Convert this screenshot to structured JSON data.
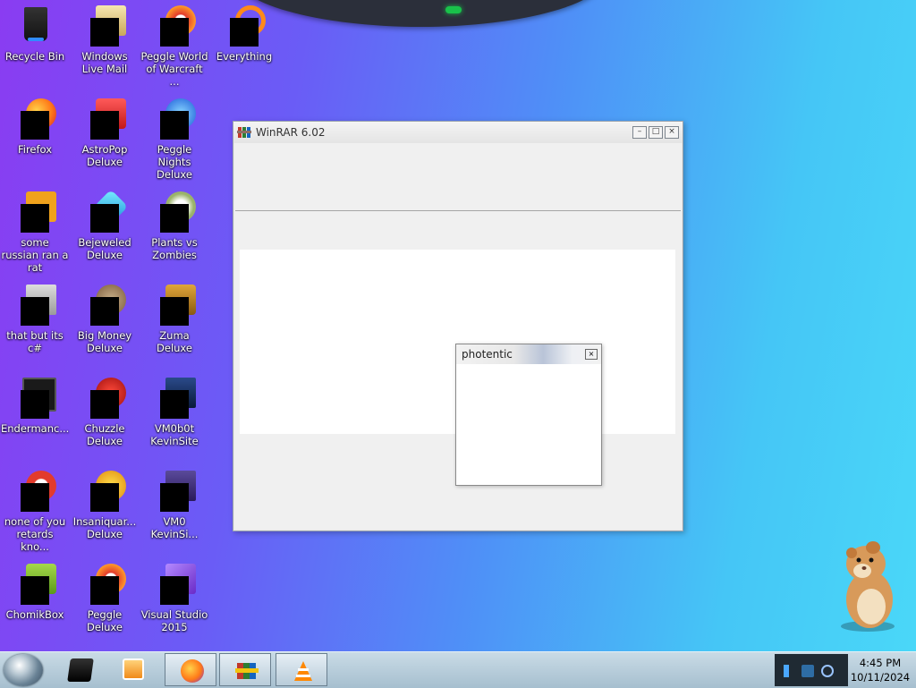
{
  "desktop": {
    "icons": [
      {
        "label": "Recycle Bin",
        "icon": "recycle-bin-icon"
      },
      {
        "label": "Windows Live Mail",
        "icon": "mail-icon"
      },
      {
        "label": "Peggle World of Warcraft ...",
        "icon": "peggle-icon"
      },
      {
        "label": "Everything",
        "icon": "search-icon"
      },
      {
        "label": "Firefox",
        "icon": "firefox-icon"
      },
      {
        "label": "AstroPop Deluxe",
        "icon": "astropop-icon"
      },
      {
        "label": "Peggle Nights Deluxe",
        "icon": "peggle-nights-icon"
      },
      {
        "label": "some russian ran a rat",
        "icon": "app-icon"
      },
      {
        "label": "Bejeweled Deluxe",
        "icon": "bejeweled-icon"
      },
      {
        "label": "Plants vs Zombies",
        "icon": "plants-vs-zombies-icon"
      },
      {
        "label": "that but its c#",
        "icon": "copy-icon"
      },
      {
        "label": "Big Money Deluxe",
        "icon": "big-money-icon"
      },
      {
        "label": "Zuma Deluxe",
        "icon": "zuma-icon"
      },
      {
        "label": "Endermanc...",
        "icon": "terminal-icon"
      },
      {
        "label": "Chuzzle Deluxe",
        "icon": "chuzzle-icon"
      },
      {
        "label": "VM0b0t KevinSite",
        "icon": "monitor-icon"
      },
      {
        "label": "none of you retards kno...",
        "icon": "app-icon"
      },
      {
        "label": "Insaniquar... Deluxe",
        "icon": "fish-icon"
      },
      {
        "label": "VM0 KevinSi...",
        "icon": "document-icon"
      },
      {
        "label": "ChomikBox",
        "icon": "chomikbox-icon"
      },
      {
        "label": "Peggle Deluxe",
        "icon": "peggle-icon"
      },
      {
        "label": "Visual Studio 2015",
        "icon": "visual-studio-icon"
      }
    ]
  },
  "winrar_window": {
    "title": "WinRAR 6.02",
    "controls": {
      "minimize": "–",
      "maximize": "□",
      "close": "×"
    }
  },
  "dialog": {
    "title": "photentic",
    "close": "×"
  },
  "taskbar": {
    "pinned": [
      {
        "icon": "media-center-icon",
        "active": false
      },
      {
        "icon": "media-player-icon",
        "active": false
      },
      {
        "icon": "firefox-icon",
        "active": true
      },
      {
        "icon": "winrar-icon",
        "active": true
      },
      {
        "icon": "vlc-icon",
        "active": true
      }
    ],
    "clock": {
      "time": "4:45 PM",
      "date": "10/11/2024"
    }
  },
  "colors": {
    "desktop_left": "#8a3cf2",
    "desktop_right": "#4ad8f8",
    "taskbar": "#b6cbd9"
  }
}
